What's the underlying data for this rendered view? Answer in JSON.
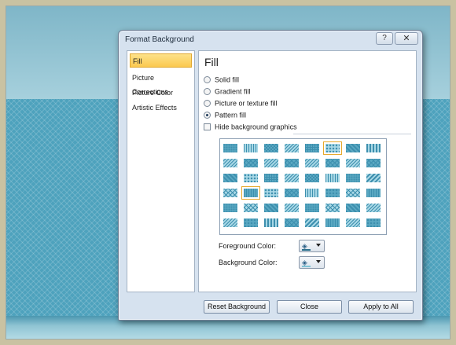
{
  "dialog": {
    "title": "Format Background",
    "help_glyph": "?",
    "close_glyph": "✕"
  },
  "sidebar": {
    "items": [
      {
        "label": "Fill",
        "active": true
      },
      {
        "label": "Picture Corrections",
        "active": false
      },
      {
        "label": "Picture Color",
        "active": false
      },
      {
        "label": "Artistic Effects",
        "active": false
      }
    ]
  },
  "fill": {
    "title": "Fill",
    "options": [
      {
        "label": "Solid fill",
        "checked": false
      },
      {
        "label": "Gradient fill",
        "checked": false
      },
      {
        "label": "Picture or texture fill",
        "checked": false
      },
      {
        "label": "Pattern fill",
        "checked": true
      }
    ],
    "hide_graphics": {
      "label": "Hide background graphics",
      "checked": false
    },
    "pattern_grid": {
      "rows": 6,
      "cols": 8,
      "selected_row": 0,
      "selected_col": 5,
      "hover_row": 3,
      "hover_col": 1
    },
    "foreground": {
      "label": "Foreground Color:",
      "color": "#2a6f8c"
    },
    "background": {
      "label": "Background Color:",
      "color": "#7fc3d6"
    }
  },
  "footer": {
    "reset_label": "Reset Background",
    "close_label": "Close",
    "apply_label": "Apply to All"
  },
  "colors": {
    "pattern_fg": "#3d8fae",
    "pattern_bg": "#a8d8e6",
    "selection": "#e7a82a"
  }
}
